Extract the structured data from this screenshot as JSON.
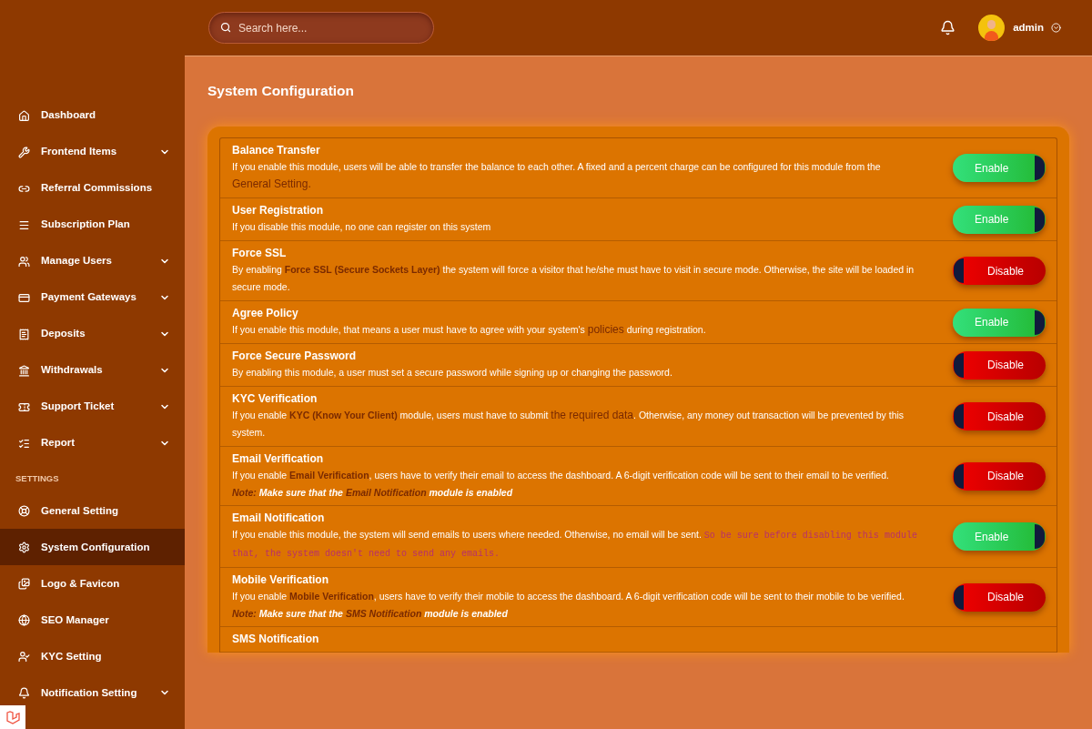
{
  "header": {
    "search": {
      "placeholder": "Search here..."
    },
    "user": {
      "name": "admin"
    }
  },
  "sidebar": {
    "items": [
      {
        "label": "Dashboard",
        "has_submenu": false,
        "selected": false
      },
      {
        "label": "Frontend Items",
        "has_submenu": true,
        "selected": false
      },
      {
        "label": "Referral Commissions",
        "has_submenu": false,
        "selected": false
      },
      {
        "label": "Subscription Plan",
        "has_submenu": false,
        "selected": false
      },
      {
        "label": "Manage Users",
        "has_submenu": true,
        "selected": false
      },
      {
        "label": "Payment Gateways",
        "has_submenu": true,
        "selected": false
      },
      {
        "label": "Deposits",
        "has_submenu": true,
        "selected": false
      },
      {
        "label": "Withdrawals",
        "has_submenu": true,
        "selected": false
      },
      {
        "label": "Support Ticket",
        "has_submenu": true,
        "selected": false
      },
      {
        "label": "Report",
        "has_submenu": true,
        "selected": false
      }
    ],
    "section_title": "SETTINGS",
    "settings_items": [
      {
        "label": "General Setting",
        "has_submenu": false,
        "selected": false
      },
      {
        "label": "System Configuration",
        "has_submenu": false,
        "selected": true
      },
      {
        "label": "Logo & Favicon",
        "has_submenu": false,
        "selected": false
      },
      {
        "label": "SEO Manager",
        "has_submenu": false,
        "selected": false
      },
      {
        "label": "KYC Setting",
        "has_submenu": false,
        "selected": false
      },
      {
        "label": "Notification Setting",
        "has_submenu": true,
        "selected": false
      }
    ]
  },
  "page_title": "System Configuration",
  "modules": [
    {
      "title": "Balance Transfer",
      "description": [
        {
          "kind": "text",
          "text": "If you enable this module, users will be able to transfer the balance to each other. A fixed and a percent charge can be configured for this module from the "
        },
        {
          "kind": "link",
          "text": "General Setting."
        }
      ],
      "toggle": {
        "on": true,
        "label": "Enable"
      }
    },
    {
      "title": "User Registration",
      "description": [
        {
          "kind": "text",
          "text": "If you disable this module, no one can register on this system"
        }
      ],
      "toggle": {
        "on": true,
        "label": "Enable"
      }
    },
    {
      "title": "Force SSL",
      "description": [
        {
          "kind": "text",
          "text": "By enabling "
        },
        {
          "kind": "strong",
          "text": "Force SSL (Secure Sockets Layer)"
        },
        {
          "kind": "text",
          "text": " the system will force a visitor that he/she must have to visit in secure mode. Otherwise, the site will be loaded in secure mode."
        }
      ],
      "toggle": {
        "on": false,
        "label": "Disable"
      }
    },
    {
      "title": "Agree Policy",
      "description": [
        {
          "kind": "text",
          "text": "If you enable this module, that means a user must have to agree with your system's "
        },
        {
          "kind": "link",
          "text": "policies"
        },
        {
          "kind": "text",
          "text": " during registration."
        }
      ],
      "toggle": {
        "on": true,
        "label": "Enable"
      }
    },
    {
      "title": "Force Secure Password",
      "description": [
        {
          "kind": "text",
          "text": "By enabling this module, a user must set a secure password while signing up or changing the password."
        }
      ],
      "toggle": {
        "on": false,
        "label": "Disable"
      }
    },
    {
      "title": "KYC Verification",
      "description": [
        {
          "kind": "text",
          "text": "If you enable "
        },
        {
          "kind": "strong",
          "text": "KYC (Know Your Client)"
        },
        {
          "kind": "text",
          "text": " module, users must have to submit "
        },
        {
          "kind": "link",
          "text": "the required data"
        },
        {
          "kind": "text",
          "text": ". Otherwise, any money out transaction will be prevented by this system."
        }
      ],
      "toggle": {
        "on": false,
        "label": "Disable"
      }
    },
    {
      "title": "Email Verification",
      "description": [
        {
          "kind": "text",
          "text": "If you enable "
        },
        {
          "kind": "strong",
          "text": "Email Verification"
        },
        {
          "kind": "text",
          "text": ", users have to verify their email to access the dashboard. A 6-digit verification code will be sent to their email to be verified."
        }
      ],
      "note": [
        {
          "kind": "label",
          "text": "Note:"
        },
        {
          "kind": "text",
          "text": " Make sure that the "
        },
        {
          "kind": "strong",
          "text": "Email Notification"
        },
        {
          "kind": "text",
          "text": " module is enabled"
        }
      ],
      "toggle": {
        "on": false,
        "label": "Disable"
      }
    },
    {
      "title": "Email Notification",
      "description": [
        {
          "kind": "text",
          "text": "If you enable this module, the system will send emails to users where needed. Otherwise, no email will be sent. "
        },
        {
          "kind": "code",
          "text": "So be sure before disabling this module that, the system doesn't need to send any emails."
        }
      ],
      "toggle": {
        "on": true,
        "label": "Enable"
      }
    },
    {
      "title": "Mobile Verification",
      "description": [
        {
          "kind": "text",
          "text": "If you enable "
        },
        {
          "kind": "strong",
          "text": "Mobile Verification"
        },
        {
          "kind": "text",
          "text": ", users have to verify their mobile to access the dashboard. A 6-digit verification code will be sent to their mobile to be verified."
        }
      ],
      "note": [
        {
          "kind": "label",
          "text": "Note:"
        },
        {
          "kind": "text",
          "text": " Make sure that the "
        },
        {
          "kind": "strong",
          "text": "SMS Notification"
        },
        {
          "kind": "text",
          "text": " module is enabled"
        }
      ],
      "toggle": {
        "on": false,
        "label": "Disable"
      }
    },
    {
      "title": "SMS Notification"
    }
  ]
}
